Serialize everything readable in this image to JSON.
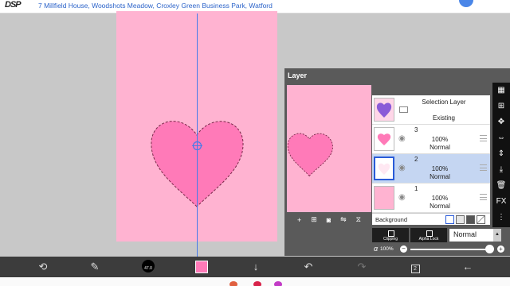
{
  "ad": {
    "address": "7 Millfield House, Woodshots Meadow, Croxley Green Business Park, Watford",
    "logo": "DSP"
  },
  "colors": {
    "canvas": "#ffb3d1",
    "heart": "#ff7ab8",
    "guide": "#4a7be8",
    "selection": "#c5d6f2"
  },
  "panel": {
    "title": "Layer",
    "selection_layer": {
      "title": "Selection Layer",
      "status": "Existing"
    },
    "layers": [
      {
        "number": "3",
        "opacity": "100%",
        "blend": "Normal",
        "thumb": "heart"
      },
      {
        "number": "2",
        "opacity": "100%",
        "blend": "Normal",
        "thumb": "empty",
        "selected": true
      },
      {
        "number": "1",
        "opacity": "100%",
        "blend": "Normal",
        "thumb": "pink"
      }
    ],
    "background_label": "Background",
    "clipping_label": "Clipping",
    "alpha_lock_label": "Alpha Lock",
    "blend_mode": "Normal",
    "alpha_symbol": "α",
    "alpha_value": "100%",
    "preview_tools": [
      "+",
      "⊞",
      "camera-icon",
      "flip-icon",
      "merge-icon"
    ]
  },
  "sidebar_icons": [
    "checker-icon",
    "grid-icon",
    "move-icon",
    "flip-h-icon",
    "flip-v-icon",
    "download-icon",
    "trash-icon",
    "FX",
    "more-icon"
  ],
  "toolbar": {
    "brush_size": "47.0",
    "layer_count": "2",
    "icons": [
      "transform-icon",
      "brush-icon",
      "color-swatch",
      "down-arrow-icon",
      "undo-icon",
      "redo-icon",
      "layers-icon",
      "back-icon"
    ]
  }
}
